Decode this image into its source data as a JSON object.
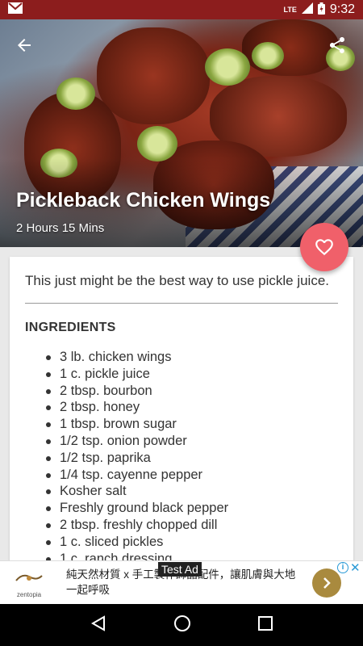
{
  "status_bar": {
    "time": "9:32",
    "network": "LTE"
  },
  "recipe": {
    "title": "Pickleback Chicken Wings",
    "total_time": "2 Hours 15 Mins",
    "description": "This just might be the best way to use pickle juice.",
    "ingredients_header": "INGREDIENTS",
    "ingredients": [
      "3 lb. chicken wings",
      "1 c. pickle juice",
      "2 tbsp. bourbon",
      "2 tbsp. honey",
      "1 tbsp. brown sugar",
      "1/2 tsp. onion powder",
      "1/2 tsp. paprika",
      "1/4 tsp. cayenne pepper",
      "Kosher salt",
      "Freshly ground black pepper",
      "2 tbsp. freshly chopped dill",
      "1 c. sliced pickles",
      "1 c. ranch dressing"
    ]
  },
  "ad": {
    "badge": "Test Ad",
    "text": "純天然材質 x 手工製作飾品配件，讓肌膚與大地一起呼吸",
    "brand": "zentopia"
  },
  "icons": {
    "back": "arrow-left-icon",
    "share": "share-icon",
    "favorite": "heart-icon",
    "gmail": "gmail-icon"
  },
  "colors": {
    "status_bar": "#8c1d1d",
    "favorite_button": "#f0606a",
    "ad_button": "#a98a3e",
    "ad_info": "#2a9ad6"
  }
}
